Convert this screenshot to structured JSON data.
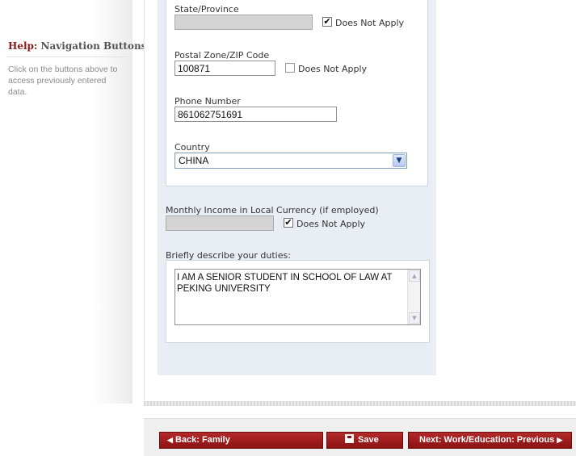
{
  "help": {
    "title_highlight": "Help:",
    "title_rest": " Navigation Buttons",
    "text": "Click on the buttons above to access previously entered data."
  },
  "address": {
    "state": {
      "label": "State/Province",
      "value": "",
      "does_not_apply": true,
      "dna_label": "Does Not Apply"
    },
    "postal": {
      "label": "Postal Zone/ZIP Code",
      "value": "100871",
      "does_not_apply": false,
      "dna_label": "Does Not Apply"
    },
    "phone": {
      "label": "Phone Number",
      "value": "861062751691"
    },
    "country": {
      "label": "Country",
      "value": "CHINA"
    }
  },
  "income": {
    "label": "Monthly Income in Local Currency (if employed)",
    "value": "",
    "does_not_apply": true,
    "dna_label": "Does Not Apply"
  },
  "duties": {
    "label": "Briefly describe your duties:",
    "value": "I AM A SENIOR STUDENT IN SCHOOL OF LAW AT PEKING UNIVERSITY"
  },
  "nav": {
    "back_label": "Back: Family",
    "save_label": "Save",
    "next_label": "Next: Work/Education: Previous",
    "back_icon": "◀",
    "next_icon": "▶",
    "save_icon": "floppy-disk-icon"
  },
  "icons": {
    "check_mark": "✔",
    "dropdown_arrow": "▼",
    "scroll_up": "▲",
    "scroll_down": "▼"
  },
  "colors": {
    "button_red": "#9e1c1c",
    "panel_blue": "#e9eef4",
    "help_title_red": "#8b1a1a"
  }
}
